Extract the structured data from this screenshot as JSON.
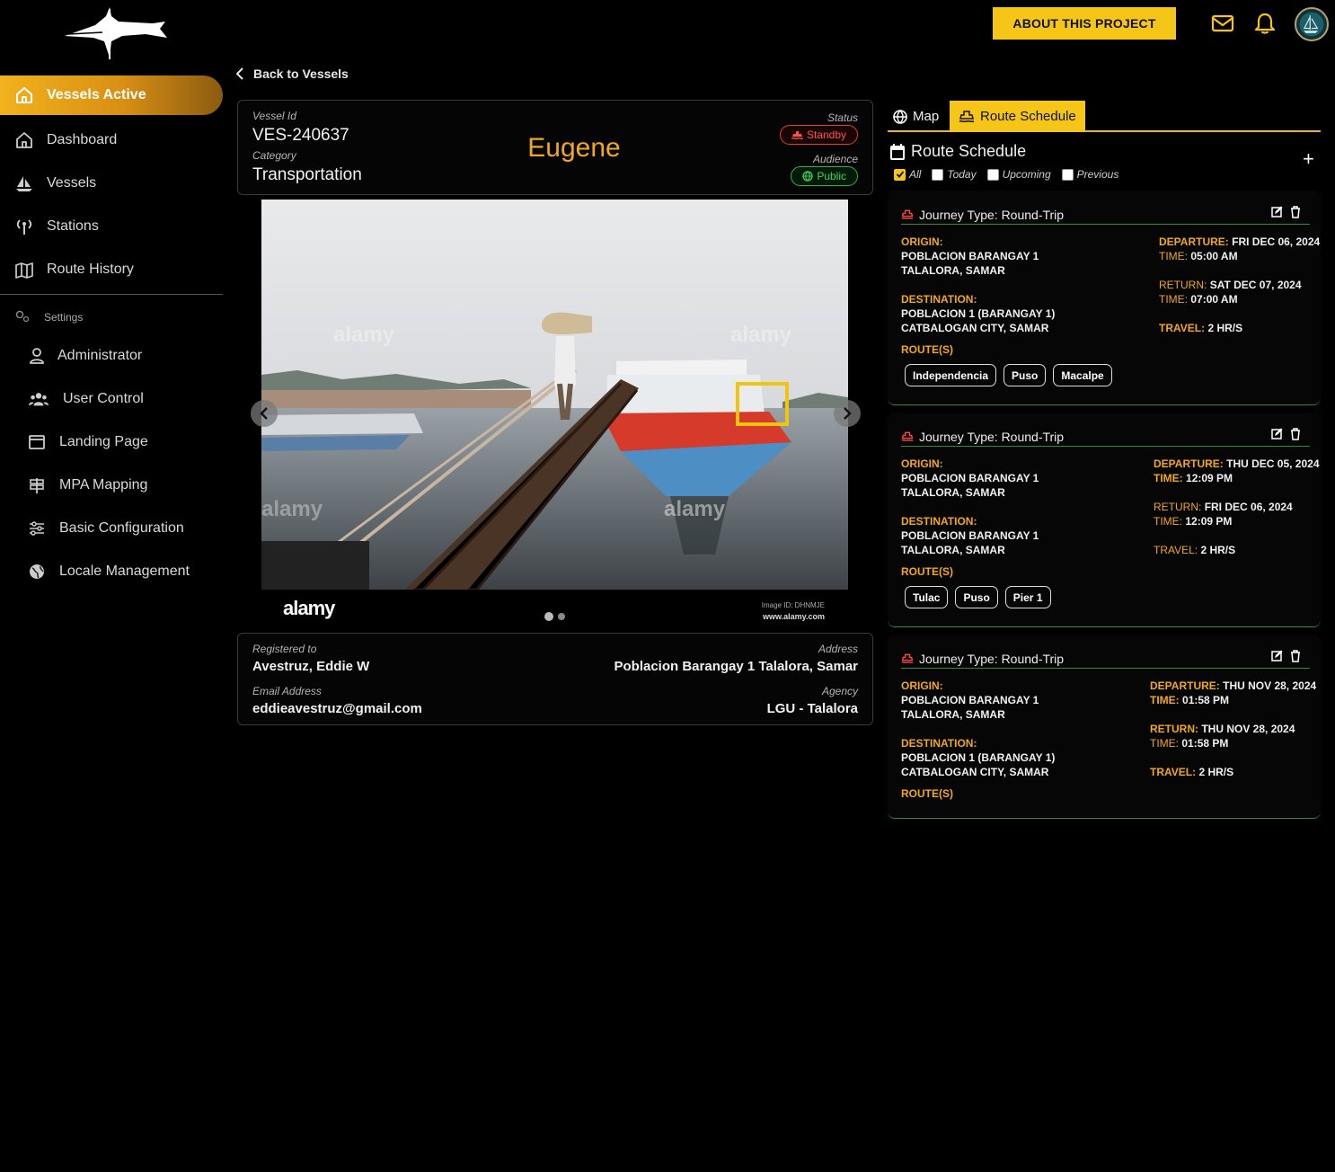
{
  "header": {
    "about_label": "ABOUT THIS PROJECT"
  },
  "sidebar": {
    "items": [
      {
        "label": "Vessels Active",
        "icon": "home-icon"
      },
      {
        "label": "Dashboard",
        "icon": "home-icon"
      },
      {
        "label": "Vessels",
        "icon": "sailboat-icon"
      },
      {
        "label": "Stations",
        "icon": "antenna-icon"
      },
      {
        "label": "Route History",
        "icon": "map-icon"
      }
    ],
    "settings_label": "Settings",
    "settings_items": [
      {
        "label": "Administrator",
        "icon": "user-icon"
      },
      {
        "label": "User Control",
        "icon": "users-icon"
      },
      {
        "label": "Landing Page",
        "icon": "window-icon"
      },
      {
        "label": "MPA Mapping",
        "icon": "signpost-icon"
      },
      {
        "label": "Basic Configuration",
        "icon": "sliders-icon"
      },
      {
        "label": "Locale Management",
        "icon": "globe-icon"
      }
    ]
  },
  "back_label": "Back to Vessels",
  "vessel": {
    "id_label": "Vessel Id",
    "id": "VES-240637",
    "category_label": "Category",
    "category": "Transportation",
    "name": "Eugene",
    "status_label": "Status",
    "status": "Standby",
    "audience_label": "Audience",
    "audience": "Public"
  },
  "photo": {
    "watermark": "alamy",
    "image_id": "Image ID: DHNMJE",
    "site": "www.alamy.com",
    "slide_count": 2,
    "active_slide": 1
  },
  "owner": {
    "registered_label": "Registered to",
    "registered": "Avestruz, Eddie W",
    "address_label": "Address",
    "address": "Poblacion Barangay 1 Talalora, Samar",
    "email_label": "Email Address",
    "email": "eddieavestruz@gmail.com",
    "agency_label": "Agency",
    "agency": "LGU - Talalora"
  },
  "tabs": {
    "map": "Map",
    "route": "Route Schedule"
  },
  "schedule": {
    "title": "Route Schedule",
    "filters": [
      {
        "label": "All",
        "checked": true
      },
      {
        "label": "Today",
        "checked": false
      },
      {
        "label": "Upcoming",
        "checked": false
      },
      {
        "label": "Previous",
        "checked": false
      }
    ],
    "keys": {
      "origin": "ORIGIN:",
      "destination": "DESTINATION:",
      "routes": "ROUTE(S)",
      "departure": "DEPARTURE:",
      "time": "TIME:",
      "return": "RETURN:",
      "travel": "TRAVEL:"
    },
    "cards": [
      {
        "title": "Journey Type: Round-Trip",
        "origin_1": "POBLACION BARANGAY 1",
        "origin_2": "TALALORA, SAMAR",
        "dest_1": "POBLACION 1 (BARANGAY 1)",
        "dest_2": "CATBALOGAN CITY, SAMAR",
        "departure": "FRI DEC 06, 2024",
        "dep_time": "05:00 AM",
        "return": "SAT DEC 07, 2024",
        "ret_time": "07:00 AM",
        "travel": "2 HR/S",
        "routes": [
          "Independencia",
          "Puso",
          "Macalpe"
        ]
      },
      {
        "title": "Journey Type: Round-Trip",
        "origin_1": "POBLACION BARANGAY 1",
        "origin_2": "TALALORA, SAMAR",
        "dest_1": "POBLACION BARANGAY 1",
        "dest_2": "TALALORA, SAMAR",
        "departure": "THU DEC 05, 2024",
        "dep_time": "12:09 PM",
        "return": "FRI DEC 06, 2024",
        "ret_time": "12:09 PM",
        "travel": "2 HR/S",
        "routes": [
          "Tulac",
          "Puso",
          "Pier 1"
        ]
      },
      {
        "title": "Journey Type: Round-Trip",
        "origin_1": "POBLACION BARANGAY 1",
        "origin_2": "TALALORA, SAMAR",
        "dest_1": "POBLACION 1 (BARANGAY 1)",
        "dest_2": "CATBALOGAN CITY, SAMAR",
        "departure": "THU NOV 28, 2024",
        "dep_time": "01:58 PM",
        "return": "THU NOV 28, 2024",
        "ret_time": "01:58 PM",
        "travel": "2 HR/S",
        "routes": []
      }
    ]
  },
  "colors": {
    "accent": "#f5c518",
    "orange": "#f0a81c",
    "standby": "#e23b3b",
    "public": "#2fb54a"
  }
}
